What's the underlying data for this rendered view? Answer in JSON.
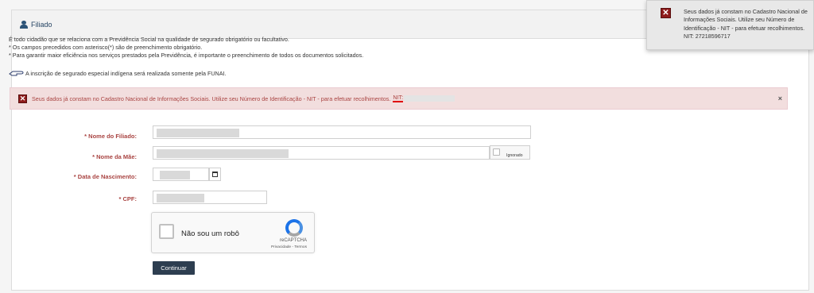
{
  "panel": {
    "title": "Filiado"
  },
  "intro": {
    "lines": [
      "É todo cidadão que se relaciona com a Previdência Social na qualidade de segurado obrigatório ou facultativo.",
      "* Os campos precedidos com asterisco(*) são de preenchimento obrigatório.",
      "* Para garantir maior eficiência nos serviços prestados pela Previdência, é importante o preenchimento de todos os documentos solicitados."
    ],
    "notice": "A inscrição de segurado especial indígena será realizada somente pela FUNAI."
  },
  "alert": {
    "message": "Seus dados já constam no Cadastro Nacional de Informações Sociais. Utilize seu Número de Identificação - NIT - para efetuar recolhimentos.",
    "nit_label": "NIT:",
    "close": "×"
  },
  "form": {
    "nome_filiado_label": "* Nome do Filiado:",
    "nome_mae_label": "* Nome da Mãe:",
    "ignorado_label": "Ignorado",
    "data_nascimento_label": "* Data de Nascimento:",
    "cpf_label": "* CPF:"
  },
  "captcha": {
    "label": "Não sou um robô",
    "brand": "reCAPTCHA",
    "links": "Privacidade - Termos"
  },
  "buttons": {
    "continuar": "Continuar"
  },
  "toast": {
    "message": "Seus dados já constam no Cadastro Nacional de Informações Sociais. Utilize seu Número de Identificação - NIT - para efetuar recolhimentos. NIT: 27218596717"
  },
  "icons": {
    "error": "error-x-icon",
    "user": "user-icon",
    "hand": "pointing-hand-icon",
    "calendar": "calendar-icon",
    "recaptcha": "recaptcha-logo-icon"
  },
  "colors": {
    "error_text": "#a94442",
    "error_bg": "#f2dede",
    "button_bg": "#2d3e50",
    "header_text": "#1f3f5f"
  }
}
